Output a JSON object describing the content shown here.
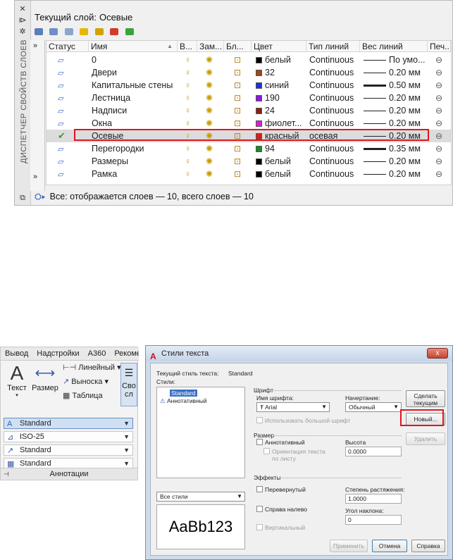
{
  "layer_manager": {
    "vertical_title": "ДИСПЕТЧЕР СВОЙСТВ СЛОЕВ",
    "current_layer_label": "Текущий слой:",
    "current_layer_value": "Осевые",
    "columns": [
      "Статус",
      "Имя",
      "В...",
      "Зам...",
      "Бл...",
      "Цвет",
      "Тип линий",
      "Вес линий",
      "Печ..."
    ],
    "rows": [
      {
        "name": "0",
        "color_name": "белый",
        "color_hex": "#000000",
        "linetype": "Continuous",
        "lineweight": "По умо...",
        "thick": false
      },
      {
        "name": "Двери",
        "color_name": "32",
        "color_hex": "#a0441a",
        "linetype": "Continuous",
        "lineweight": "0.20 мм",
        "thick": false
      },
      {
        "name": "Капитальные стены",
        "color_name": "синий",
        "color_hex": "#1a2fe8",
        "linetype": "Continuous",
        "lineweight": "0.50 мм",
        "thick": true
      },
      {
        "name": "Лестница",
        "color_name": "190",
        "color_hex": "#8a18e6",
        "linetype": "Continuous",
        "lineweight": "0.20 мм",
        "thick": false
      },
      {
        "name": "Надписи",
        "color_name": "24",
        "color_hex": "#8a2012",
        "linetype": "Continuous",
        "lineweight": "0.20 мм",
        "thick": false
      },
      {
        "name": "Окна",
        "color_name": "фиолет...",
        "color_hex": "#e01ad6",
        "linetype": "Continuous",
        "lineweight": "0.20 мм",
        "thick": false
      },
      {
        "name": "Осевые",
        "color_name": "красный",
        "color_hex": "#e01a1a",
        "linetype": "осевая",
        "lineweight": "0.20 мм",
        "thick": false,
        "current": true
      },
      {
        "name": "Перегородки",
        "color_name": "94",
        "color_hex": "#1a8a28",
        "linetype": "Continuous",
        "lineweight": "0.35 мм",
        "thick": true
      },
      {
        "name": "Размеры",
        "color_name": "белый",
        "color_hex": "#000000",
        "linetype": "Continuous",
        "lineweight": "0.20 мм",
        "thick": false
      },
      {
        "name": "Рамка",
        "color_name": "белый",
        "color_hex": "#000000",
        "linetype": "Continuous",
        "lineweight": "0.20 мм",
        "thick": false
      }
    ],
    "status_line": "Все: отображается слоев — 10, всего слоев — 10",
    "expand_arrows": "»"
  },
  "ribbon": {
    "tabs": [
      "Вывод",
      "Надстройки",
      "A360",
      "Рекоме"
    ],
    "text_button": "Текст",
    "dimension_button": "Размер",
    "linear_label": "Линейный",
    "leader_label": "Выноска",
    "table_label": "Таблица",
    "props_label": "Сво",
    "props_label2": "сл",
    "text_style": "Standard",
    "dim_style": "ISO-25",
    "mleader_style": "Standard",
    "table_style": "Standard",
    "panel_caption": "Аннотации"
  },
  "text_style_dialog": {
    "title": "Стили текста",
    "close": "x",
    "current_style_label": "Текущий стиль текста:",
    "current_style_value": "Standard",
    "styles_label": "Стили:",
    "styles": [
      "Standard",
      "Аннотативный"
    ],
    "font_group": "Шрифт",
    "font_name_label": "Имя шрифта:",
    "font_name_value": "Arial",
    "font_style_label": "Начертание:",
    "font_style_value": "Обычный",
    "big_font_label": "Использовать большой шрифт",
    "size_group": "Размер",
    "annotative_label": "Аннотативный",
    "orientation_label_1": "Ориентация текста",
    "orientation_label_2": "по листу",
    "height_label": "Высота",
    "height_value": "0.0000",
    "filter_value": "Все стили",
    "preview_text": "AaBb123",
    "effects_group": "Эффекты",
    "upside_down_label": "Перевернутый",
    "backwards_label": "Справа налево",
    "vertical_label": "Вертикальный",
    "width_factor_label": "Степень растяжения:",
    "width_factor_value": "1.0000",
    "oblique_label": "Угол наклона:",
    "oblique_value": "0",
    "set_current_1": "Сделать",
    "set_current_2": "текущим",
    "new_button": "Новый...",
    "delete_button": "Удалить",
    "apply_button": "Применить",
    "cancel_button": "Отмена",
    "help_button": "Справка"
  }
}
